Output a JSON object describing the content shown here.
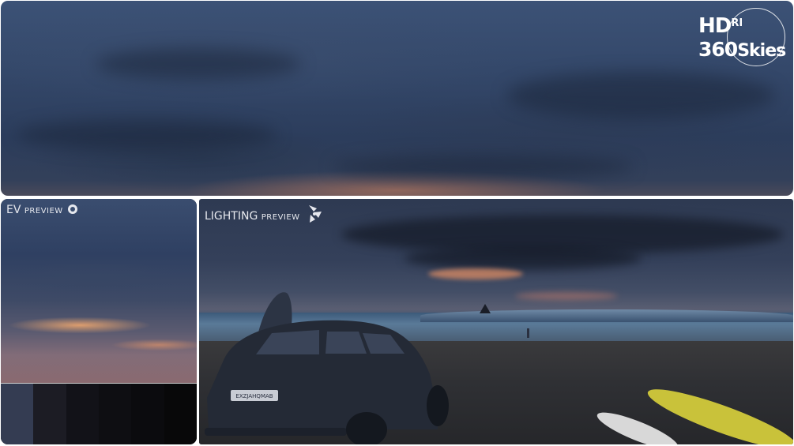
{
  "logo": {
    "line1": "HD",
    "line1_small": "RI",
    "line2_num": "360",
    "line2_text": "Skies"
  },
  "ev_panel": {
    "label_main": "EV",
    "label_small": "PREVIEW",
    "icon": "aperture-icon",
    "exposure_strip_colors": [
      "#343c52",
      "#1c1c24",
      "#121218",
      "#0e0e12",
      "#0b0b0e",
      "#080809"
    ]
  },
  "lighting_panel": {
    "label_main": "LIGHTING",
    "label_small": "PREVIEW",
    "icon": "light-bulb-icon",
    "license_plate": "EXZJAHQMAB"
  },
  "colors": {
    "sky_top": "#3c5276",
    "sky_bottom": "#33405a",
    "sunset_glow": "#d2825f",
    "surfboard_yellow": "#c9c23a",
    "label_text": "#e6e8ee"
  }
}
